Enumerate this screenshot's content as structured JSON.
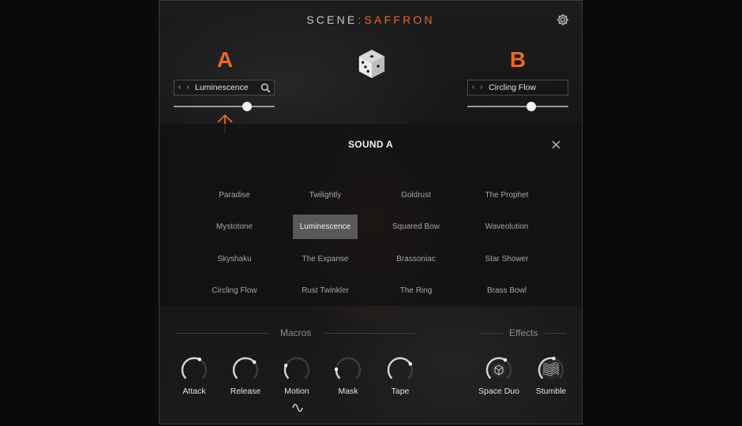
{
  "app": {
    "title_left": "SCENE",
    "title_sep": ":",
    "title_right": "SAFFRON",
    "accent_color": "#e46a2b"
  },
  "icons": {
    "settings": "gear-icon",
    "randomize": "dice-icon",
    "prev_next": "chevron-left-right-icon",
    "search": "search-icon",
    "close": "close-icon",
    "indicator": "arrow-up-icon",
    "modulation": "sine-wave-icon"
  },
  "slot_a": {
    "letter": "A",
    "arrows": "‹ ›",
    "preset": "Luminescence",
    "volume": 0.73
  },
  "slot_b": {
    "letter": "B",
    "arrows": "‹ ›",
    "preset": "Circling Flow",
    "volume": 0.63
  },
  "browser": {
    "title": "SOUND A",
    "selected": "Luminescence",
    "presets": [
      "Paradise",
      "Twilightly",
      "Goldrust",
      "The Prophet",
      "Mystotone",
      "Luminescence",
      "Squared Bow",
      "Waveolution",
      "Skyshaku",
      "The Expanse",
      "Brassoniac",
      "Star Shower",
      "Circling Flow",
      "Rust Twinkler",
      "The Ring",
      "Brass Bowl"
    ]
  },
  "macros": {
    "label": "Macros",
    "knobs": [
      {
        "label": "Attack",
        "value": 0.6
      },
      {
        "label": "Release",
        "value": 0.68
      },
      {
        "label": "Motion",
        "value": 0.25
      },
      {
        "label": "Mask",
        "value": 0.18
      },
      {
        "label": "Tape",
        "value": 0.72
      }
    ]
  },
  "effects": {
    "label": "Effects",
    "knobs": [
      {
        "label": "Space Duo",
        "value": 0.62,
        "icon": "cube-icon"
      },
      {
        "label": "Stumble",
        "value": 0.55,
        "icon": "wave-lines-icon"
      }
    ]
  }
}
